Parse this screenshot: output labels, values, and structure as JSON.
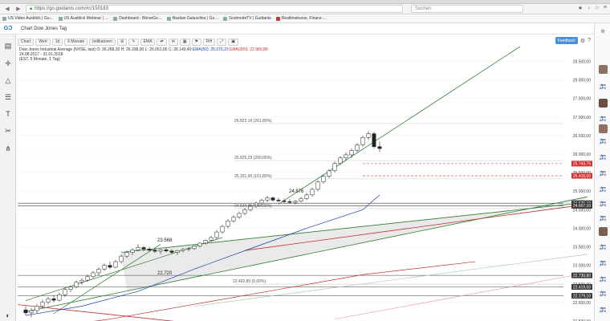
{
  "browser": {
    "url": "https://go.guidants.com/#c/150183",
    "search_placeholder": "Suchen",
    "bookmarks": [
      "US Video Ausblick | Gu…",
      "US Ausblick Webinar | …",
      "Dashboard - BörseGo…",
      "Bastian Galuschka | Gu…",
      "GodmodeTV | Guidants",
      "Realtimekurse, Finanz-…"
    ]
  },
  "app": {
    "chart_title": "Chart Dow Jones Tag",
    "toolbar": [
      "Chart",
      "Wert",
      "1d",
      "6 Monate",
      "Indikatoren",
      "EMA",
      "RH"
    ],
    "feedback_label": "Feedback"
  },
  "info": {
    "line1": "Dow Jones Industrial Average (NYSE, last)  O: 26.268,20  H: 26.338,00  L: 26.051,00  C: 26.149,40",
    "ema50": "EMA(50): 25.070,23",
    "ema200": "EMA(200): 22.989,89",
    "line2": "24.08.2017 - 31.01.2018",
    "line3": "(EST, 5 Monate, 1 Tag)"
  },
  "colors": {
    "ema50": "#1a3fa8",
    "ema200": "#c03030",
    "trend_green": "#2e7d32",
    "channel_fill": "#d8d8d8",
    "marker_red": "#d03030",
    "marker_dark": "#3a3a3a"
  },
  "chart_data": {
    "type": "candlestick",
    "title": "Chart Dow Jones Tag",
    "ylim": [
      21500,
      28900
    ],
    "axis_ticks": [
      28500,
      28000,
      27500,
      27000,
      26500,
      26000,
      25500,
      25000,
      24500,
      24000,
      23500,
      23000,
      22500,
      22000,
      21500
    ],
    "price_markers": [
      {
        "label": "25.743,75",
        "value": 25743.75,
        "color": "red"
      },
      {
        "label": "25.416,00",
        "value": 25416.0,
        "color": "red"
      },
      {
        "label": "24.676,10",
        "value": 24676.1,
        "color": "dark"
      },
      {
        "label": "24.607,10",
        "value": 24607.1,
        "color": "dark"
      },
      {
        "label": "22.730,80",
        "value": 22730.8,
        "color": "dark"
      },
      {
        "label": "22.419,50",
        "value": 22419.5,
        "color": "dark"
      },
      {
        "label": "22.179,10",
        "value": 22179.1,
        "color": "dark"
      }
    ],
    "fib_levels": [
      {
        "label": "26.823,16 (261,80%)",
        "value": 26823.16
      },
      {
        "label": "25.825,29 (200,00%)",
        "value": 25825.29
      },
      {
        "label": "25.331,96 (161,80%)",
        "value": 25331.96
      },
      {
        "label": "24.534,00 (100,00%)",
        "value": 24534.0
      },
      {
        "label": "22.492,80 (0,00%)",
        "value": 22492.8
      }
    ],
    "annotations": [
      "23.568",
      "22.720",
      "24.876"
    ],
    "ohlc": [
      [
        21800,
        21900,
        21650,
        21720
      ],
      [
        21720,
        21850,
        21600,
        21780
      ],
      [
        21780,
        21960,
        21700,
        21900
      ],
      [
        21900,
        22080,
        21850,
        22010
      ],
      [
        22010,
        22150,
        21950,
        22100
      ],
      [
        22100,
        22200,
        22000,
        22060
      ],
      [
        22060,
        22260,
        22030,
        22210
      ],
      [
        22210,
        22400,
        22150,
        22350
      ],
      [
        22350,
        22450,
        22280,
        22420
      ],
      [
        22420,
        22600,
        22380,
        22550
      ],
      [
        22550,
        22650,
        22480,
        22600
      ],
      [
        22600,
        22750,
        22560,
        22700
      ],
      [
        22700,
        22850,
        22650,
        22800
      ],
      [
        22800,
        22950,
        22720,
        22900
      ],
      [
        22900,
        23050,
        22850,
        23000
      ],
      [
        23000,
        23100,
        22900,
        22950
      ],
      [
        22950,
        23150,
        22920,
        23100
      ],
      [
        23100,
        23300,
        23050,
        23250
      ],
      [
        23250,
        23400,
        23200,
        23350
      ],
      [
        23350,
        23470,
        23280,
        23420
      ],
      [
        23420,
        23568,
        23380,
        23480
      ],
      [
        23480,
        23520,
        23380,
        23440
      ],
      [
        23440,
        23500,
        23360,
        23410
      ],
      [
        23410,
        23460,
        23330,
        23380
      ],
      [
        23380,
        23450,
        23300,
        23420
      ],
      [
        23420,
        23470,
        23350,
        23390
      ],
      [
        23390,
        23440,
        23300,
        23350
      ],
      [
        23350,
        23420,
        23280,
        23400
      ],
      [
        23400,
        23460,
        23350,
        23430
      ],
      [
        23430,
        23500,
        23380,
        23450
      ],
      [
        23450,
        23540,
        23420,
        23520
      ],
      [
        23520,
        23620,
        23480,
        23600
      ],
      [
        23600,
        23700,
        23560,
        23680
      ],
      [
        23680,
        23800,
        23640,
        23750
      ],
      [
        23750,
        23950,
        23700,
        23900
      ],
      [
        23900,
        24100,
        23850,
        24050
      ],
      [
        24050,
        24250,
        24000,
        24200
      ],
      [
        24200,
        24350,
        24150,
        24300
      ],
      [
        24300,
        24450,
        24250,
        24400
      ],
      [
        24400,
        24550,
        24350,
        24500
      ],
      [
        24500,
        24650,
        24450,
        24600
      ],
      [
        24600,
        24720,
        24550,
        24680
      ],
      [
        24680,
        24800,
        24620,
        24760
      ],
      [
        24760,
        24876,
        24700,
        24820
      ],
      [
        24820,
        24860,
        24720,
        24760
      ],
      [
        24760,
        24820,
        24700,
        24740
      ],
      [
        24740,
        24800,
        24680,
        24720
      ],
      [
        24720,
        24790,
        24660,
        24700
      ],
      [
        24700,
        24760,
        24640,
        24730
      ],
      [
        24730,
        24850,
        24700,
        24800
      ],
      [
        24800,
        24950,
        24760,
        24900
      ],
      [
        24900,
        25100,
        24850,
        25050
      ],
      [
        25050,
        25300,
        25000,
        25250
      ],
      [
        25250,
        25450,
        25200,
        25400
      ],
      [
        25400,
        25600,
        25350,
        25550
      ],
      [
        25550,
        25800,
        25500,
        25750
      ],
      [
        25750,
        25950,
        25700,
        25900
      ],
      [
        25900,
        26050,
        25820,
        25980
      ],
      [
        25980,
        26150,
        25900,
        26100
      ],
      [
        26100,
        26300,
        26050,
        26250
      ],
      [
        26250,
        26500,
        26200,
        26450
      ],
      [
        26450,
        26616,
        26380,
        26550
      ],
      [
        26550,
        26600,
        26150,
        26200
      ],
      [
        26200,
        26340,
        26050,
        26150
      ]
    ],
    "ema50": [
      [
        0,
        21650
      ],
      [
        10,
        21900
      ],
      [
        20,
        22300
      ],
      [
        30,
        22900
      ],
      [
        40,
        23450
      ],
      [
        50,
        24000
      ],
      [
        60,
        24500
      ],
      [
        63,
        24900
      ]
    ],
    "ema200": [
      [
        0,
        21250
      ],
      [
        15,
        21550
      ],
      [
        30,
        21950
      ],
      [
        45,
        22350
      ],
      [
        60,
        22750
      ],
      [
        80,
        23100
      ]
    ],
    "trendlines": [
      {
        "name": "steep",
        "from": [
          45,
          24650
        ],
        "to": [
          88,
          28900
        ]
      },
      {
        "name": "lower",
        "from": [
          0,
          21750
        ],
        "to": [
          100,
          24850
        ]
      },
      {
        "name": "upper",
        "from": [
          17,
          23350
        ],
        "to": [
          100,
          24700
        ]
      }
    ]
  },
  "sidebar": {
    "tools": [
      "layout-icon",
      "crosshair-icon",
      "triangle-icon",
      "fib-icon",
      "text-icon",
      "scissors-icon",
      "fan-icon"
    ],
    "bottom_tool": "contrast-icon"
  }
}
